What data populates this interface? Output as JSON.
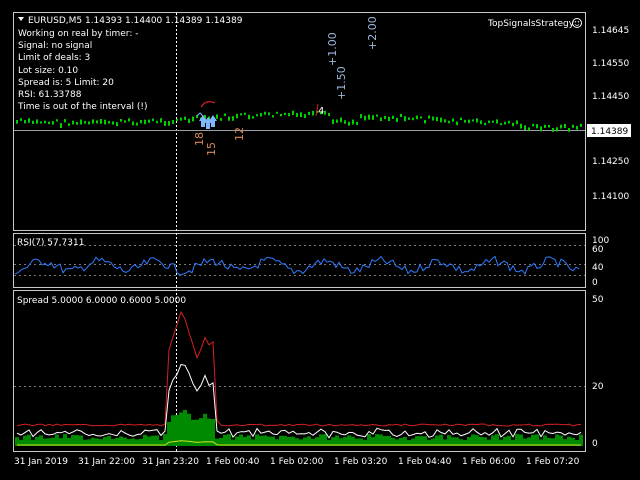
{
  "header": {
    "symbol_line": "EURUSD,M5  1.14393 1.14400 1.14389 1.14389",
    "strategy_name": "TopSignalsStrategy"
  },
  "info_lines": [
    "Working on real by timer:  -",
    "Signal: no signal",
    "Limit of deals: 3",
    "Lot size: 0.10",
    "Spread is: 5 Limit: 20",
    "RSI: 61.33788",
    "Time is out of the interval (!)"
  ],
  "price_axis": {
    "ticks": [
      "1.14645",
      "1.14550",
      "1.14450",
      "1.14250",
      "1.14100"
    ],
    "current": "1.14389"
  },
  "trade_labels": {
    "profits": [
      "+1.50",
      "+1.00",
      "+2.00"
    ],
    "counts": [
      "18",
      "15",
      "12"
    ],
    "marker": "4"
  },
  "rsi_panel": {
    "title": "RSI(7) 57.7311",
    "levels": [
      "100",
      "60",
      "40",
      "0"
    ]
  },
  "spread_panel": {
    "title": "Spread 5.0000 6.0000 0.6000 5.0000",
    "levels": [
      "50",
      "20",
      "0"
    ]
  },
  "time_axis": [
    "31 Jan 2019",
    "31 Jan 22:00",
    "31 Jan 23:20",
    "1 Feb 00:40",
    "1 Feb 02:00",
    "1 Feb 03:20",
    "1 Feb 04:40",
    "1 Feb 06:00",
    "1 Feb 07:20"
  ],
  "colors": {
    "candle": "#00d000",
    "rsi_line": "#2f7cff",
    "spread_fill": "#008a00",
    "spread_max": "#d42020",
    "spread_avg": "#ffffff",
    "spread_min": "#cfe020",
    "profit_text": "#9fb8dc",
    "count_text": "#d98b5a",
    "arrow": "#7fb8ff"
  }
}
